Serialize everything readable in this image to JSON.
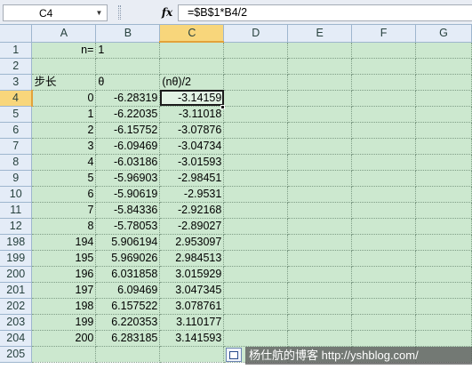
{
  "formula_bar": {
    "name_box": "C4",
    "fx_label": "fx",
    "formula": "=$B$1*B4/2"
  },
  "columns": [
    "A",
    "B",
    "C",
    "D",
    "E",
    "F",
    "G"
  ],
  "selected_column": "C",
  "rows": [
    {
      "h": "1",
      "a": "n=",
      "b": "1",
      "c": ""
    },
    {
      "h": "2",
      "a": "",
      "b": "",
      "c": ""
    },
    {
      "h": "3",
      "a": "步长",
      "b": "θ",
      "c": "(nθ)/2"
    },
    {
      "h": "4",
      "a": "0",
      "b": "-6.28319",
      "c": "-3.14159"
    },
    {
      "h": "5",
      "a": "1",
      "b": "-6.22035",
      "c": "-3.11018"
    },
    {
      "h": "6",
      "a": "2",
      "b": "-6.15752",
      "c": "-3.07876"
    },
    {
      "h": "7",
      "a": "3",
      "b": "-6.09469",
      "c": "-3.04734"
    },
    {
      "h": "8",
      "a": "4",
      "b": "-6.03186",
      "c": "-3.01593"
    },
    {
      "h": "9",
      "a": "5",
      "b": "-5.96903",
      "c": "-2.98451"
    },
    {
      "h": "10",
      "a": "6",
      "b": "-5.90619",
      "c": "-2.9531"
    },
    {
      "h": "11",
      "a": "7",
      "b": "-5.84336",
      "c": "-2.92168"
    },
    {
      "h": "12",
      "a": "8",
      "b": "-5.78053",
      "c": "-2.89027"
    },
    {
      "h": "198",
      "a": "194",
      "b": "5.906194",
      "c": "2.953097"
    },
    {
      "h": "199",
      "a": "195",
      "b": "5.969026",
      "c": "2.984513"
    },
    {
      "h": "200",
      "a": "196",
      "b": "6.031858",
      "c": "3.015929"
    },
    {
      "h": "201",
      "a": "197",
      "b": "6.09469",
      "c": "3.047345"
    },
    {
      "h": "202",
      "a": "198",
      "b": "6.157522",
      "c": "3.078761"
    },
    {
      "h": "203",
      "a": "199",
      "b": "6.220353",
      "c": "3.110177"
    },
    {
      "h": "204",
      "a": "200",
      "b": "6.283185",
      "c": "3.141593"
    },
    {
      "h": "205",
      "a": "",
      "b": "",
      "c": ""
    }
  ],
  "watermark": "杨仕航的博客 http://yshblog.com/"
}
